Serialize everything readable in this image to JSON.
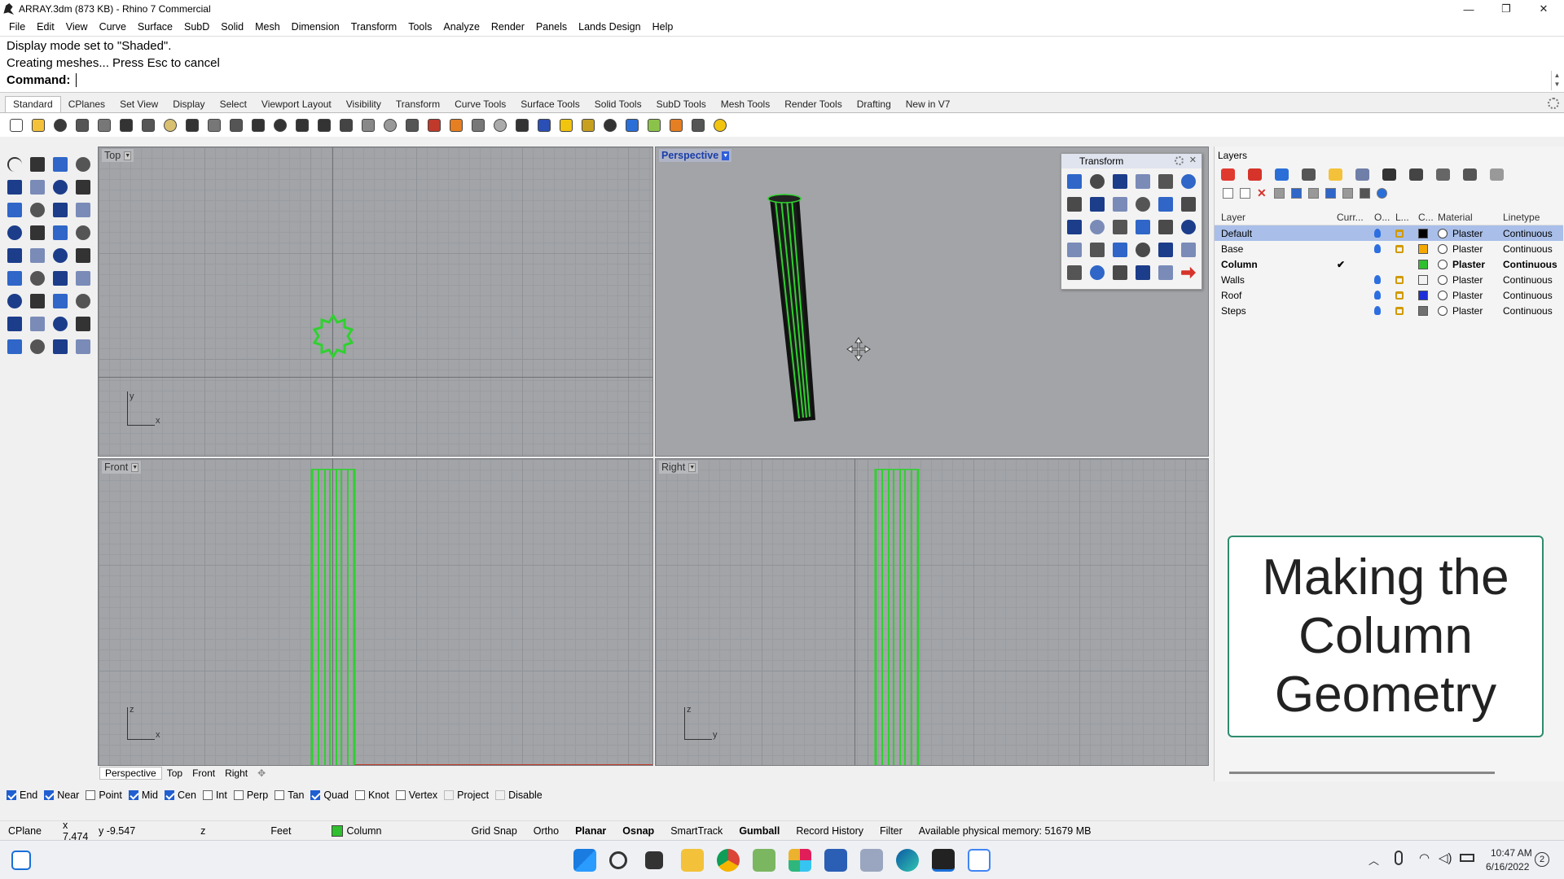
{
  "window": {
    "title": "ARRAY.3dm (873 KB) - Rhino 7 Commercial",
    "minimize": "—",
    "maximize": "❐",
    "close": "✕"
  },
  "menu": [
    "File",
    "Edit",
    "View",
    "Curve",
    "Surface",
    "SubD",
    "Solid",
    "Mesh",
    "Dimension",
    "Transform",
    "Tools",
    "Analyze",
    "Render",
    "Panels",
    "Lands Design",
    "Help"
  ],
  "command": {
    "history": [
      "Display mode set to \"Shaded\".",
      "Creating meshes... Press Esc to cancel"
    ],
    "prompt": "Command:",
    "value": ""
  },
  "toolbar_tabs": [
    "Standard",
    "CPlanes",
    "Set View",
    "Display",
    "Select",
    "Viewport Layout",
    "Visibility",
    "Transform",
    "Curve Tools",
    "Surface Tools",
    "Solid Tools",
    "SubD Tools",
    "Mesh Tools",
    "Render Tools",
    "Drafting",
    "New in V7"
  ],
  "viewports": {
    "top": {
      "label": "Top",
      "axis_x": "x",
      "axis_y": "y"
    },
    "perspective": {
      "label": "Perspective"
    },
    "front": {
      "label": "Front",
      "axis_x": "x",
      "axis_y": "z"
    },
    "right": {
      "label": "Right",
      "axis_x": "y",
      "axis_y": "z"
    }
  },
  "transform_panel": {
    "title": "Transform"
  },
  "layers": {
    "panel_title": "Layers",
    "columns": [
      "Layer",
      "Curr...",
      "O...",
      "L...",
      "C...",
      "Material",
      "Linetype"
    ],
    "rows": [
      {
        "name": "Default",
        "current": "",
        "color": "#000000",
        "material": "Plaster",
        "linetype": "Continuous",
        "selected": true
      },
      {
        "name": "Base",
        "current": "",
        "color": "#f5a800",
        "material": "Plaster",
        "linetype": "Continuous"
      },
      {
        "name": "Column",
        "current": "✔",
        "color": "#2fbf2f",
        "material": "Plaster",
        "linetype": "Continuous",
        "bold": true
      },
      {
        "name": "Walls",
        "current": "",
        "color": "#f2f2f2",
        "material": "Plaster",
        "linetype": "Continuous"
      },
      {
        "name": "Roof",
        "current": "",
        "color": "#1f2fd8",
        "material": "Plaster",
        "linetype": "Continuous"
      },
      {
        "name": "Steps",
        "current": "",
        "color": "#707070",
        "material": "Plaster",
        "linetype": "Continuous"
      }
    ]
  },
  "overlay": {
    "text": [
      "Making the",
      "Column",
      "Geometry"
    ]
  },
  "viewport_tabs": [
    "Perspective",
    "Top",
    "Front",
    "Right"
  ],
  "osnap": [
    {
      "label": "End",
      "checked": true
    },
    {
      "label": "Near",
      "checked": true
    },
    {
      "label": "Point",
      "checked": false
    },
    {
      "label": "Mid",
      "checked": true
    },
    {
      "label": "Cen",
      "checked": true
    },
    {
      "label": "Int",
      "checked": false
    },
    {
      "label": "Perp",
      "checked": false
    },
    {
      "label": "Tan",
      "checked": false
    },
    {
      "label": "Quad",
      "checked": true
    },
    {
      "label": "Knot",
      "checked": false
    },
    {
      "label": "Vertex",
      "checked": false
    },
    {
      "label": "Project",
      "checked": false,
      "disabled": true
    },
    {
      "label": "Disable",
      "checked": false,
      "disabled": true
    }
  ],
  "status": {
    "cplane": "CPlane",
    "x": "x 7.474",
    "y": "y -9.547",
    "z": "z",
    "units": "Feet",
    "layer": "Column",
    "layer_color": "#2fbf2f",
    "toggles": [
      {
        "label": "Grid Snap",
        "on": false
      },
      {
        "label": "Ortho",
        "on": false
      },
      {
        "label": "Planar",
        "on": true
      },
      {
        "label": "Osnap",
        "on": true
      },
      {
        "label": "SmartTrack",
        "on": false
      },
      {
        "label": "Gumball",
        "on": true
      },
      {
        "label": "Record History",
        "on": false
      },
      {
        "label": "Filter",
        "on": false
      }
    ],
    "memory": "Available physical memory: 51679 MB"
  },
  "taskbar": {
    "time": "10:47 AM",
    "date": "6/16/2022",
    "notif": "2"
  },
  "colors": {
    "geometry": "#2fd12f",
    "accent": "#1f5fd1",
    "selection": "#a9bfe9"
  }
}
